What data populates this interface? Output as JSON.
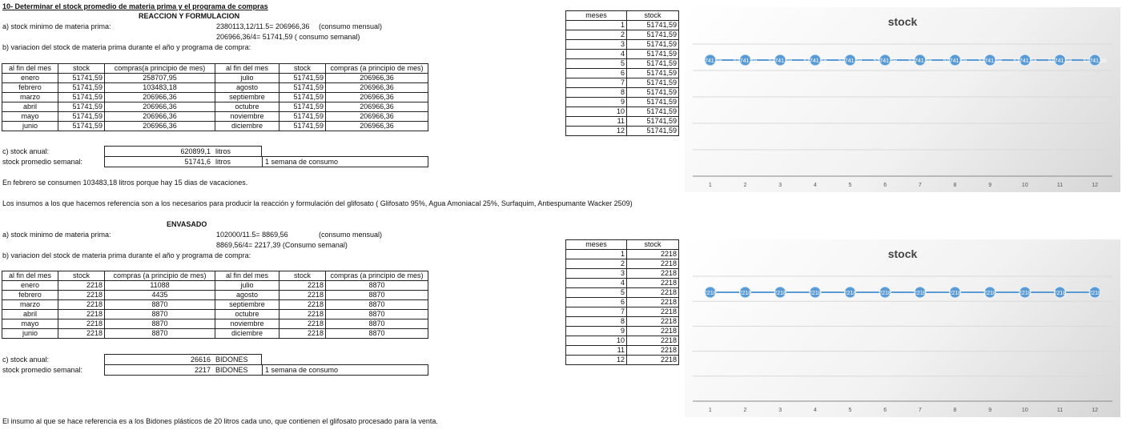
{
  "heading": "10- Determinar el stock promedio de materia prima y el programa de compras",
  "header_row": [
    "al fin del mes",
    "stock",
    "compras(a principio de mes)",
    "al fin del mes",
    "stock",
    "compras (a principio de mes)"
  ],
  "sections": [
    {
      "title": "REACCION Y FORMULACION",
      "a_label": "a) stock minimo de materia prima:",
      "a_calc1": "2380113,12/11.5= 206966,36",
      "a_note1": "(consumo mensual)",
      "a_calc2": "206966,36/4= 51741,59 ( consumo semanal)",
      "a_note2": "",
      "b_label": "b) variacion del stock de materia prima durante el año y programa de compra:",
      "header": [
        "al fin del mes",
        "stock",
        "compras(a principio de mes)",
        "al fin del mes",
        "stock",
        "compras (a principio de mes)"
      ],
      "rows": [
        [
          "enero",
          "51741,59",
          "258707,95",
          "julio",
          "51741,59",
          "206966,36"
        ],
        [
          "febrero",
          "51741,59",
          "103483,18",
          "agosto",
          "51741,59",
          "206966,36"
        ],
        [
          "marzo",
          "51741,59",
          "206966,36",
          "septiembre",
          "51741,59",
          "206966,36"
        ],
        [
          "abril",
          "51741,59",
          "206966,36",
          "octubre",
          "51741,59",
          "206966,36"
        ],
        [
          "mayo",
          "51741,59",
          "206966,36",
          "noviembre",
          "51741,59",
          "206966,36"
        ],
        [
          "junio",
          "51741,59",
          "206966,36",
          "diciembre",
          "51741,59",
          "206966,36"
        ]
      ],
      "c_label": "c) stock anual:",
      "c_value": "620899,1",
      "c_unit": "litros",
      "prom_label": "stock promedio semanal:",
      "prom_value": "51741,6",
      "prom_unit": "litros",
      "semana": "1 semana de consumo",
      "note1": "En febrero se consumen 103483,18 litros porque hay 15 dias de vacaciones.",
      "note2": "Los insumos a los que hacemos referencia son a los necesarios para producir la reacción y formulación del glifosato ( Glifosato 95%, Agua Amoniacal 25%, Surfaquim, Antiespumante Wacker 2509)",
      "side_header": [
        "meses",
        "stock"
      ],
      "side_rows": [
        [
          "1",
          "51741,59"
        ],
        [
          "2",
          "51741,59"
        ],
        [
          "3",
          "51741,59"
        ],
        [
          "4",
          "51741,59"
        ],
        [
          "5",
          "51741,59"
        ],
        [
          "6",
          "51741,59"
        ],
        [
          "7",
          "51741,59"
        ],
        [
          "8",
          "51741,59"
        ],
        [
          "9",
          "51741,59"
        ],
        [
          "10",
          "51741,59"
        ],
        [
          "11",
          "51741,59"
        ],
        [
          "12",
          "51741,59"
        ]
      ]
    },
    {
      "title": "ENVASADO",
      "a_label": "a) stock minimo de materia prima:",
      "a_calc1": "102000/11.5= 8869,56",
      "a_note1": "(consumo mensual)",
      "a_calc2": "8869,56/4= 2217,39 (Consumo semanal)",
      "a_note2": "",
      "b_label": "b) variacion del stock de materia prima durante el año y programa de compra:",
      "header": [
        "al fin del mes",
        "stock",
        "compras (a principio de mes)",
        "al fin del mes",
        "stock",
        "compras (a principio de mes)"
      ],
      "rows": [
        [
          "enero",
          "2218",
          "11088",
          "julio",
          "2218",
          "8870"
        ],
        [
          "febrero",
          "2218",
          "4435",
          "agosto",
          "2218",
          "8870"
        ],
        [
          "marzo",
          "2218",
          "8870",
          "septiembre",
          "2218",
          "8870"
        ],
        [
          "abril",
          "2218",
          "8870",
          "octubre",
          "2218",
          "8870"
        ],
        [
          "mayo",
          "2218",
          "8870",
          "noviembre",
          "2218",
          "8870"
        ],
        [
          "junio",
          "2218",
          "8870",
          "diciembre",
          "2218",
          "8870"
        ]
      ],
      "c_label": "c) stock anual:",
      "c_value": "26616",
      "c_unit": "BIDONES",
      "prom_label": "stock promedio semanal:",
      "prom_value": "2217",
      "prom_unit": "BIDONES",
      "semana": "1 semana de consumo",
      "note1": "El insumo al que se hace referencia es a los Bidones plásticos de 20 litros cada uno, que contienen el glifosato procesado para la venta.",
      "note2": "",
      "side_header": [
        "meses",
        "stock"
      ],
      "side_rows": [
        [
          "1",
          "2218"
        ],
        [
          "2",
          "2218"
        ],
        [
          "3",
          "2218"
        ],
        [
          "4",
          "2218"
        ],
        [
          "5",
          "2218"
        ],
        [
          "6",
          "2218"
        ],
        [
          "7",
          "2218"
        ],
        [
          "8",
          "2218"
        ],
        [
          "9",
          "2218"
        ],
        [
          "10",
          "2218"
        ],
        [
          "11",
          "2218"
        ],
        [
          "12",
          "2218"
        ]
      ]
    }
  ],
  "chart_data": [
    {
      "type": "line",
      "title": "stock",
      "x": [
        1,
        2,
        3,
        4,
        5,
        6,
        7,
        8,
        9,
        10,
        11,
        12
      ],
      "series": [
        {
          "values": [
            51741.59,
            51741.59,
            51741.59,
            51741.59,
            51741.59,
            51741.59,
            51741.59,
            51741.59,
            51741.59,
            51741.59,
            51741.59,
            51741.59
          ]
        }
      ],
      "data_labels": [
        "51741,59",
        "51741,59",
        "51741,59",
        "51741,59",
        "51741,59",
        "51741,59",
        "51741,59",
        "51741,59",
        "51741,59",
        "51741,59",
        "51741,59",
        "51741,59"
      ],
      "grid": true,
      "color": "#5b9bd5"
    },
    {
      "type": "line",
      "title": "stock",
      "x": [
        1,
        2,
        3,
        4,
        5,
        6,
        7,
        8,
        9,
        10,
        11,
        12
      ],
      "series": [
        {
          "values": [
            2218,
            2218,
            2218,
            2218,
            2218,
            2218,
            2218,
            2218,
            2218,
            2218,
            2218,
            2218
          ]
        }
      ],
      "data_labels": [
        "2218",
        "2218",
        "2218",
        "2218",
        "2218",
        "2218",
        "2218",
        "2218",
        "2218",
        "2218",
        "2218",
        "2218"
      ],
      "grid": true,
      "color": "#5b9bd5"
    }
  ]
}
